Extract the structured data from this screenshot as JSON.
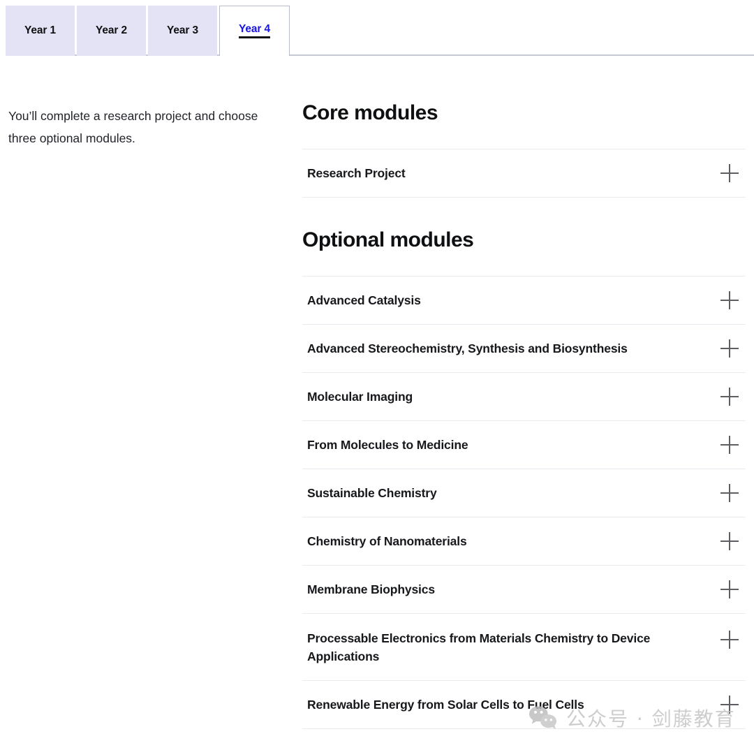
{
  "tabs": [
    {
      "label": "Year 1",
      "active": false
    },
    {
      "label": "Year 2",
      "active": false
    },
    {
      "label": "Year 3",
      "active": false
    },
    {
      "label": "Year 4",
      "active": true
    }
  ],
  "intro": {
    "text": "You’ll complete a research project and choose three optional modules."
  },
  "sections": {
    "core": {
      "heading": "Core modules",
      "items": [
        {
          "title": "Research Project",
          "toggle_icon": "plus-icon"
        }
      ]
    },
    "optional": {
      "heading": "Optional modules",
      "items": [
        {
          "title": "Advanced Catalysis",
          "toggle_icon": "plus-icon"
        },
        {
          "title": "Advanced Stereochemistry, Synthesis and Biosynthesis",
          "toggle_icon": "plus-icon"
        },
        {
          "title": "Molecular Imaging",
          "toggle_icon": "plus-icon"
        },
        {
          "title": "From Molecules to Medicine",
          "toggle_icon": "plus-icon"
        },
        {
          "title": "Sustainable Chemistry",
          "toggle_icon": "plus-icon"
        },
        {
          "title": "Chemistry of Nanomaterials",
          "toggle_icon": "plus-icon"
        },
        {
          "title": "Membrane Biophysics",
          "toggle_icon": "plus-icon"
        },
        {
          "title": "Processable Electronics from Materials Chemistry to Device Applications",
          "toggle_icon": "plus-icon"
        },
        {
          "title": "Renewable Energy from Solar Cells to Fuel Cells",
          "toggle_icon": "plus-icon"
        }
      ]
    }
  },
  "watermark": {
    "icon": "wechat-icon",
    "text": "公众号 · 剑藤教育"
  },
  "colors": {
    "tab_inactive_bg": "#e4e3f5",
    "tab_active_text": "#1a14e0",
    "divider": "#e7eaee",
    "plus_icon": "#5d5d62",
    "heading_text": "#0f1012"
  }
}
